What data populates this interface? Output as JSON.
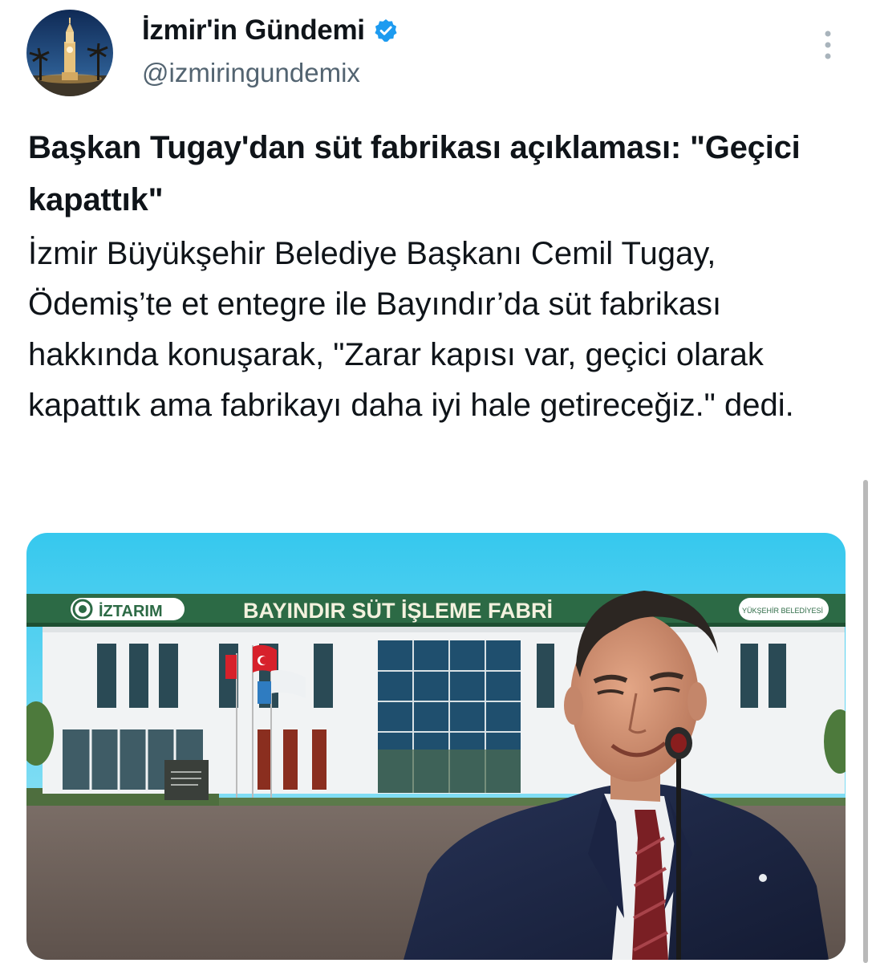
{
  "author": {
    "display_name": "İzmir'in Gündemi",
    "handle": "@izmiringundemix",
    "verified": true,
    "verified_icon": "verified-badge-icon",
    "avatar": "avatar-clock-tower-night"
  },
  "menu": {
    "icon": "more-vertical-icon"
  },
  "tweet": {
    "headline": "Başkan Tugay'dan süt fabrikası açıklaması: \"Geçici kapattık\"",
    "body": "İzmir Büyükşehir Belediye Başkanı Cemil Tugay, Ödemiş’te et entegre ile Bayındır’da süt fabrikası hakkında konuşarak, \"Zarar kapısı var, geçici olarak kapattık ama fabrikayı daha iyi hale getireceğiz.\" dedi."
  },
  "media": {
    "sign_left": "İZTARIM",
    "sign_main": "BAYINDIR SÜT İŞLEME FABRİ",
    "sign_right": "YÜKŞEHİR BELEDİYESİ"
  },
  "colors": {
    "text": "#0f1419",
    "secondary": "#536471",
    "verified": "#1d9bf0",
    "sign_green": "#2c6a45"
  }
}
